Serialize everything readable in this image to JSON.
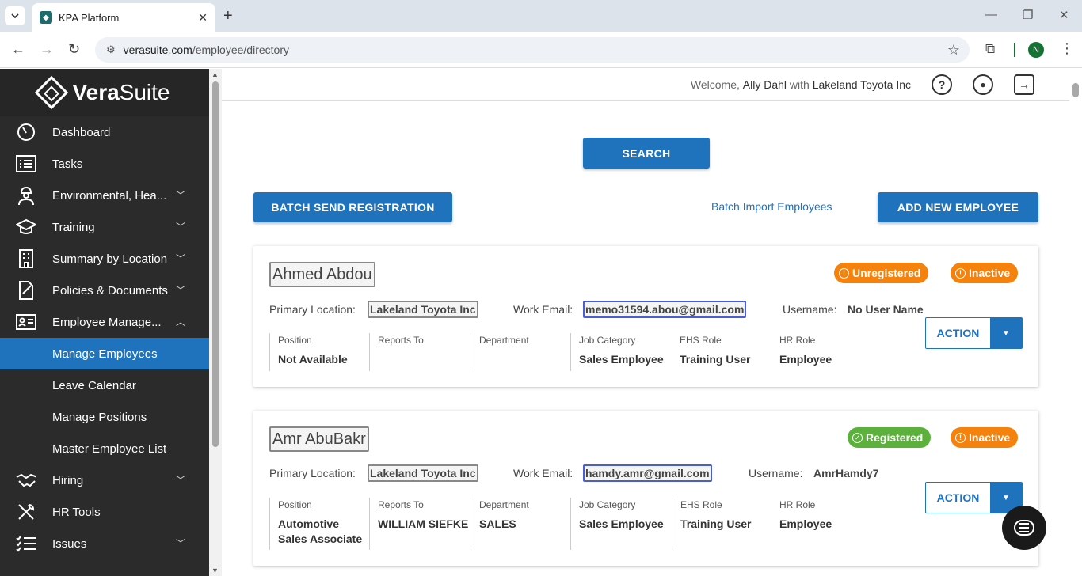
{
  "browser": {
    "tab_title": "KPA Platform",
    "url_host": "verasuite.com",
    "url_path": "/employee/directory",
    "profile_initial": "N"
  },
  "sidebar": {
    "logo_light": "Vera",
    "logo_bold": "Suite",
    "items": [
      {
        "label": "Dashboard",
        "icon": "dashboard-icon"
      },
      {
        "label": "Tasks",
        "icon": "tasks-icon"
      },
      {
        "label": "Environmental, Hea...",
        "icon": "worker-icon"
      },
      {
        "label": "Training",
        "icon": "graduation-cap-icon"
      },
      {
        "label": "Summary by Location",
        "icon": "building-icon"
      },
      {
        "label": "Policies & Documents",
        "icon": "document-icon"
      },
      {
        "label": "Employee Manage...",
        "icon": "id-card-icon"
      },
      {
        "label": "Manage Employees"
      },
      {
        "label": "Leave Calendar"
      },
      {
        "label": "Manage Positions"
      },
      {
        "label": "Master Employee List"
      },
      {
        "label": "Hiring",
        "icon": "handshake-icon"
      },
      {
        "label": "HR Tools",
        "icon": "tools-icon"
      },
      {
        "label": "Issues",
        "icon": "list-check-icon"
      }
    ]
  },
  "header": {
    "welcome": "Welcome,",
    "user": "Ally Dahl",
    "with": "with",
    "company": "Lakeland Toyota Inc"
  },
  "actions": {
    "search": "SEARCH",
    "batch_send": "BATCH SEND REGISTRATION",
    "batch_import": "Batch Import Employees",
    "add_new": "ADD NEW EMPLOYEE"
  },
  "labels": {
    "primary_location": "Primary Location:",
    "work_email": "Work Email:",
    "username": "Username:",
    "position": "Position",
    "reports_to": "Reports To",
    "department": "Department",
    "job_category": "Job Category",
    "ehs_role": "EHS Role",
    "hr_role": "HR Role",
    "action": "ACTION"
  },
  "employees": [
    {
      "name": "Ahmed Abdou",
      "registration": "Unregistered",
      "status": "Inactive",
      "location": "Lakeland Toyota Inc",
      "email": "memo31594.abou@gmail.com",
      "username": "No User Name",
      "position": "Not Available",
      "reports_to": "",
      "department": "",
      "job_category": "Sales Employee",
      "ehs_role": "Training User",
      "hr_role": "Employee"
    },
    {
      "name": "Amr AbuBakr",
      "registration": "Registered",
      "status": "Inactive",
      "location": "Lakeland Toyota Inc",
      "email": "hamdy.amr@gmail.com",
      "username": "AmrHamdy7",
      "position_line1": "Automotive",
      "position_line2": "Sales Associate",
      "reports_to": "WILLIAM SIEFKE",
      "department": "SALES",
      "job_category": "Sales Employee",
      "ehs_role": "Training User",
      "hr_role": "Employee"
    }
  ],
  "colors": {
    "primary": "#1f73bd",
    "sidebar_bg": "#2b2b2b",
    "badge_orange": "#f5820d",
    "badge_green": "#5cb13d"
  }
}
